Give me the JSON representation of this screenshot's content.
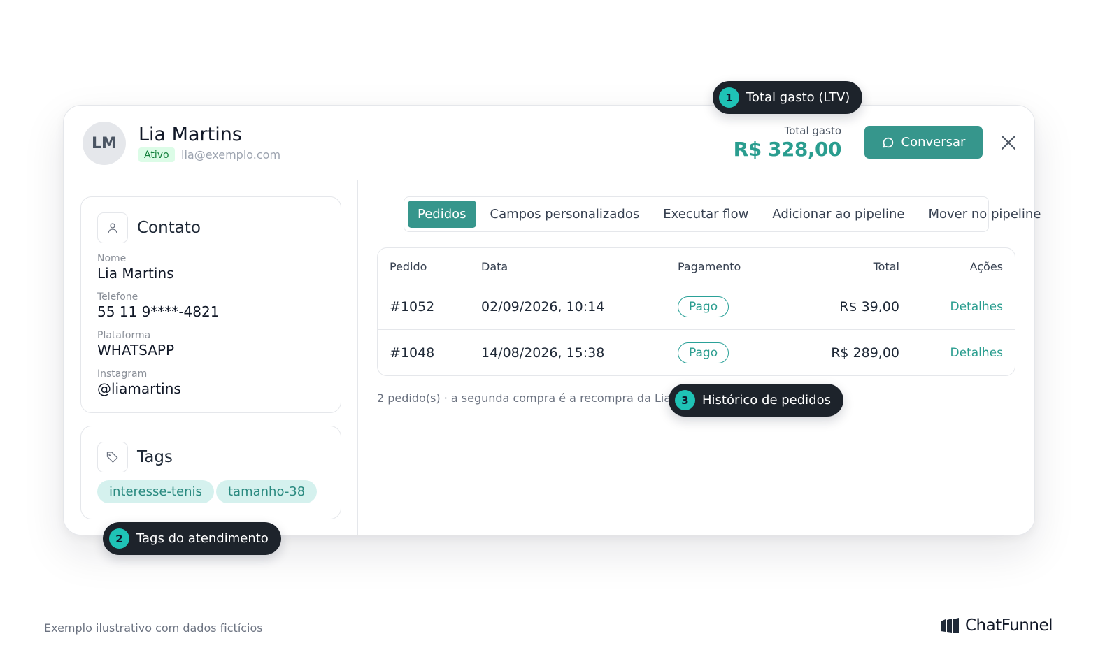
{
  "contact_header": {
    "initials": "LM",
    "name": "Lia Martins",
    "status": "Ativo",
    "email": "lia@exemplo.com",
    "ltv_label": "Total gasto",
    "ltv_value": "R$ 328,00",
    "chat_button_label": "Conversar"
  },
  "contact_panel": {
    "title": "Contato",
    "fields": [
      {
        "label": "Nome",
        "value": "Lia Martins"
      },
      {
        "label": "Telefone",
        "value": "55 11 9****-4821"
      },
      {
        "label": "Plataforma",
        "value": "WHATSAPP"
      },
      {
        "label": "Instagram",
        "value": "@liamartins"
      }
    ]
  },
  "tags_panel": {
    "title": "Tags",
    "tags": [
      "interesse-tenis",
      "tamanho-38"
    ]
  },
  "tabs": [
    "Pedidos",
    "Campos personalizados",
    "Executar flow",
    "Adicionar ao pipeline",
    "Mover no pipeline"
  ],
  "active_tab": "Pedidos",
  "orders": {
    "columns": [
      "Pedido",
      "Data",
      "Pagamento",
      "Total",
      "Ações"
    ],
    "rows": [
      {
        "id": "#1052",
        "date": "02/09/2026, 10:14",
        "payment": "Pago",
        "total": "R$ 39,00",
        "action": "Detalhes"
      },
      {
        "id": "#1048",
        "date": "14/08/2026, 15:38",
        "payment": "Pago",
        "total": "R$ 289,00",
        "action": "Detalhes"
      }
    ],
    "footnote": "2 pedido(s) · a segunda compra é a recompra da Lia"
  },
  "callouts": [
    {
      "number": "1",
      "label": "Total gasto (LTV)"
    },
    {
      "number": "2",
      "label": "Tags do atendimento"
    },
    {
      "number": "3",
      "label": "Histórico de pedidos"
    }
  ],
  "footer": {
    "note": "Exemplo ilustrativo com dados fictícios",
    "brand": "ChatFunnel"
  },
  "colors": {
    "accent": "#36968c",
    "accent_text": "#2a9d8f",
    "callout_bg": "#1d232b",
    "callout_badge": "#1fc3b6",
    "status_green_bg": "#dcfce7",
    "tag_bg": "#d5f1ee"
  },
  "icons": [
    "chat-bubble-icon",
    "close-icon",
    "user-icon",
    "tag-icon",
    "chatfunnel-logo-icon"
  ]
}
